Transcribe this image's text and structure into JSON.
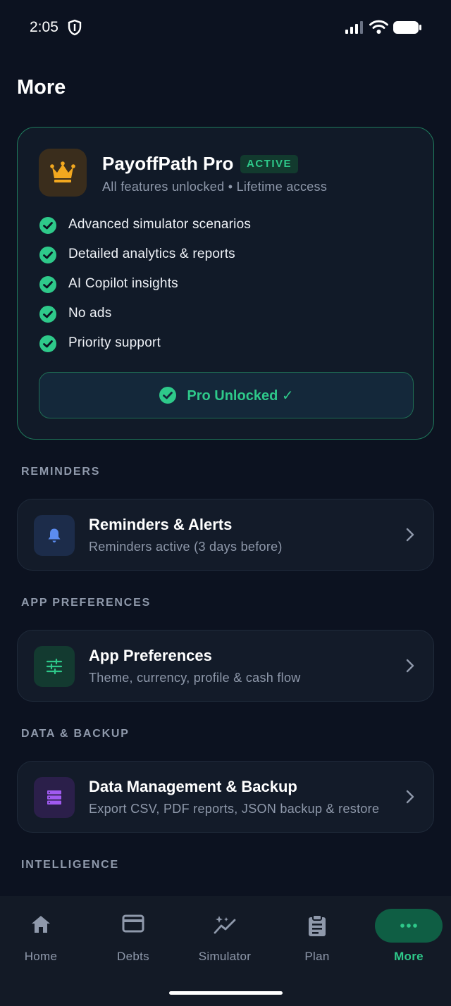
{
  "status_bar": {
    "time": "2:05"
  },
  "page": {
    "title": "More"
  },
  "pro_card": {
    "title": "PayoffPath Pro",
    "badge": "ACTIVE",
    "subtitle": "All features unlocked • Lifetime access",
    "features": [
      "Advanced simulator scenarios",
      "Detailed analytics & reports",
      "AI Copilot insights",
      "No ads",
      "Priority support"
    ],
    "button_label": "Pro Unlocked ✓"
  },
  "sections": {
    "reminders": {
      "label": "REMINDERS",
      "title": "Reminders & Alerts",
      "subtitle": "Reminders active (3 days before)"
    },
    "app_preferences": {
      "label": "APP PREFERENCES",
      "title": "App Preferences",
      "subtitle": "Theme, currency, profile & cash flow"
    },
    "data_backup": {
      "label": "DATA & BACKUP",
      "title": "Data Management & Backup",
      "subtitle": "Export CSV, PDF reports, JSON backup & restore"
    },
    "intelligence": {
      "label": "INTELLIGENCE"
    }
  },
  "bottom_nav": {
    "items": [
      {
        "label": "Home",
        "icon": "home-icon"
      },
      {
        "label": "Debts",
        "icon": "card-icon"
      },
      {
        "label": "Simulator",
        "icon": "sparkle-chart-icon"
      },
      {
        "label": "Plan",
        "icon": "clipboard-icon"
      },
      {
        "label": "More",
        "icon": "more-dots-icon"
      }
    ],
    "active_index": 4
  },
  "colors": {
    "background": "#0c1220",
    "accent_green": "#2ec98a",
    "crown_gold": "#f2a81f",
    "bell_blue": "#5b8cf0",
    "stack_purple": "#a05af0"
  }
}
